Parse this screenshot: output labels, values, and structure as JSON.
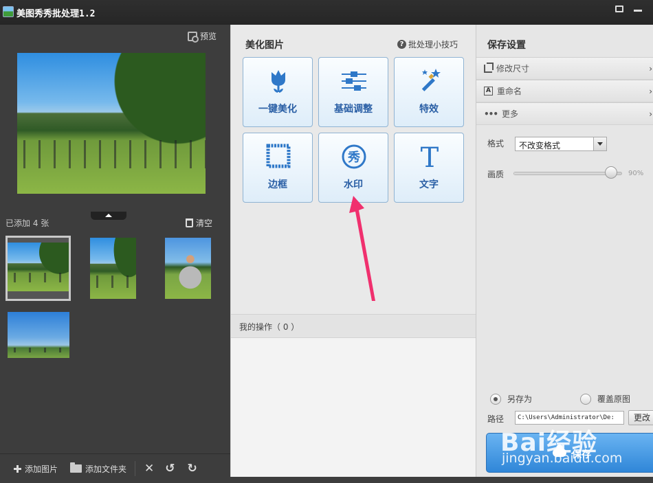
{
  "app": {
    "title": "美图秀秀批处理1.2"
  },
  "left": {
    "preview_label": "预览",
    "added_count": "已添加 4 张",
    "clear_label": "清空",
    "toolbar": {
      "add_image": "添加图片",
      "add_folder": "添加文件夹"
    }
  },
  "middle": {
    "title": "美化图片",
    "tips": "批处理小技巧",
    "tools": [
      {
        "label": "一键美化",
        "icon": "tulip-icon"
      },
      {
        "label": "基础调整",
        "icon": "sliders-icon"
      },
      {
        "label": "特效",
        "icon": "magic-wand-icon"
      },
      {
        "label": "边框",
        "icon": "frame-icon"
      },
      {
        "label": "水印",
        "icon": "watermark-icon",
        "glyph": "秀"
      },
      {
        "label": "文字",
        "icon": "text-icon",
        "glyph": "T"
      }
    ],
    "my_ops": "我的操作（ 0 ）"
  },
  "right": {
    "title": "保存设置",
    "sections": [
      {
        "label": "修改尺寸",
        "icon": "crop-icon"
      },
      {
        "label": "重命名",
        "icon": "rename-icon"
      },
      {
        "label": "更多",
        "icon": "more-icon"
      }
    ],
    "format_label": "格式",
    "format_value": "不改变格式",
    "quality_label": "画质",
    "quality_value": "90%",
    "quality_fraction": 0.9,
    "save_as": "另存为",
    "overwrite": "覆盖原图",
    "path_label": "路径",
    "path_value": "C:\\Users\\Administrator\\De:",
    "change_btn": "更改",
    "save_btn": "保存"
  },
  "watermark": {
    "brand": "Bai经验",
    "url": "jingyan.baidu.com"
  },
  "colors": {
    "accent": "#2f86d8",
    "tool_label": "#2a5fa5",
    "arrow": "#f0306e"
  }
}
